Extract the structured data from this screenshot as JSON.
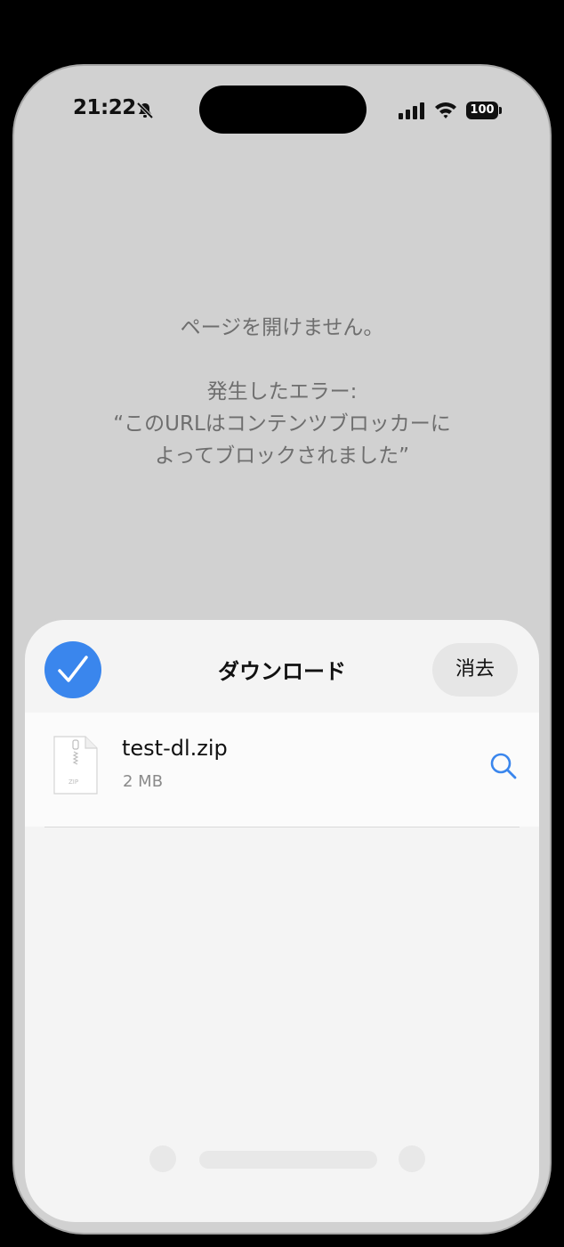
{
  "status_bar": {
    "time": "21:22",
    "battery": "100",
    "icons": [
      "bell-slash-icon",
      "signal-icon",
      "wifi-icon",
      "battery-icon"
    ]
  },
  "error": {
    "line1": "ページを開けません。",
    "line2": "発生したエラー:",
    "line3": "“このURLはコンテンツブロッカーに",
    "line4": "よってブロックされました”"
  },
  "downloads_sheet": {
    "title": "ダウンロード",
    "clear_label": "消去",
    "done_icon": "checkmark-icon",
    "accent_color": "#3a86ed",
    "items": [
      {
        "name": "test-dl.zip",
        "size": "2 MB",
        "file_type": "ZIP",
        "icon": "zip-file-icon",
        "action_icon": "search-icon"
      }
    ]
  }
}
